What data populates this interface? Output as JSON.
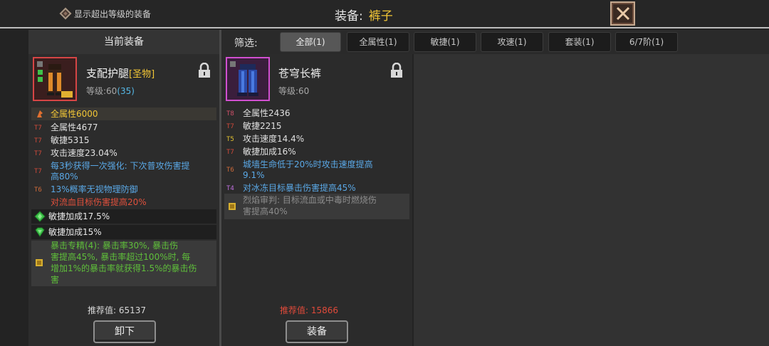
{
  "header": {
    "show_over_level_label": "显示超出等级的装备",
    "title_label": "装备:",
    "title_value": "裤子"
  },
  "left": {
    "header": "当前装备",
    "item": {
      "name": "支配护腿",
      "tag": "[圣物]",
      "level_label": "等级:60",
      "level_extra": "(35)"
    },
    "top_stat": "全属性6000",
    "stats": [
      {
        "tier": "T7",
        "text": "全属性4677"
      },
      {
        "tier": "T7",
        "text": "敏捷5315"
      },
      {
        "tier": "T7",
        "text": "攻击速度23.04%"
      },
      {
        "tier": "T7",
        "text": "每3秒获得一次强化: 下次普攻伤害提"
      },
      {
        "tier": "",
        "text": "高80%"
      },
      {
        "tier": "T6",
        "text": "13%概率无视物理防御"
      },
      {
        "tier": "",
        "text": "对流血目标伤害提高20%"
      }
    ],
    "gems": [
      "敏捷加成17.5%",
      "敏捷加成15%"
    ],
    "set_lines": [
      "暴击专精(4): 暴击率30%, 暴击伤",
      "害提高45%, 暴击率超过100%时, 每",
      "增加1%的暴击率就获得1.5%的暴击伤",
      "害"
    ],
    "recommend_label": "推荐值:",
    "recommend_value": "65137",
    "button_label": "卸下"
  },
  "filter": {
    "label": "筛选:",
    "tabs": [
      "全部(1)",
      "全属性(1)",
      "敏捷(1)",
      "攻速(1)",
      "套装(1)",
      "6/7阶(1)"
    ]
  },
  "middle": {
    "item": {
      "name": "苍穹长裤",
      "level_label": "等级:60"
    },
    "stats": [
      {
        "tier": "T8",
        "text": "全属性2436"
      },
      {
        "tier": "T7",
        "text": "敏捷2215"
      },
      {
        "tier": "T5",
        "text": "攻击速度14.4%"
      },
      {
        "tier": "T7",
        "text": "敏捷加成16%"
      },
      {
        "tier": "T6",
        "text": "城墙生命低于20%时攻击速度提高"
      },
      {
        "tier": "",
        "text": "9.1%"
      },
      {
        "tier": "T4",
        "text": "对冰冻目标暴击伤害提高45%"
      }
    ],
    "set_lines": [
      "烈焰审判: 目标流血或中毒时燃烧伤",
      "害提高40%"
    ],
    "recommend_label": "推荐值:",
    "recommend_value": "15866",
    "button_label": "装备"
  },
  "colors": {
    "accent_gold": "#f2c636",
    "stat_blue": "#5aa8e6",
    "stat_red": "#e0503c",
    "set_green": "#5fbf3a",
    "recommend_red": "#e04a3a"
  },
  "icons": [
    "diamond-checkbox-icon",
    "close-icon",
    "lock-icon",
    "relic-pants-icon",
    "blue-pants-icon",
    "rune-icon",
    "green-gem-icon",
    "set-scroll-icon"
  ]
}
